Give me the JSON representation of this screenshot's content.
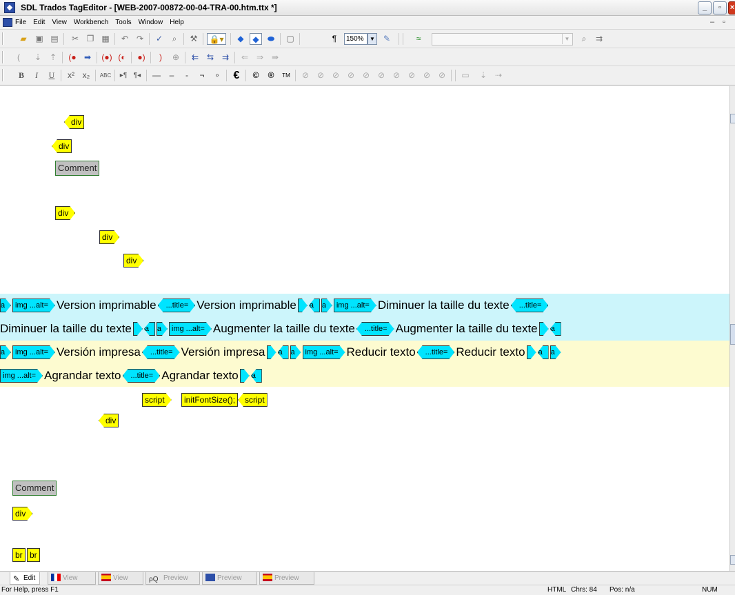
{
  "window": {
    "title": "SDL Trados TagEditor - [WEB-2007-00872-00-04-TRA-00.htm.ttx *]",
    "min_label": "_",
    "max_label": "▫",
    "close_label": "×"
  },
  "menu": {
    "items": [
      "File",
      "Edit",
      "View",
      "Workbench",
      "Tools",
      "Window",
      "Help"
    ],
    "mdi_min": "–",
    "mdi_restore": "▫"
  },
  "toolbar": {
    "zoom_value": "150%"
  },
  "editor": {
    "structure_tags": {
      "div1": "div",
      "div2": "div",
      "comment1": "Comment",
      "div3": "div",
      "div4": "div",
      "div5": "div",
      "script_open": "script",
      "script_content": "initFontSize();",
      "script_close": "script",
      "div6": "div",
      "comment2": "Comment",
      "div7": "div",
      "br1": "br",
      "br2": "br"
    },
    "source_segment": {
      "a": "a",
      "img_alt": "img ...alt=",
      "title_attr": "...title=",
      "text1": "Version imprimable",
      "text2": "Version imprimable",
      "text3": "Diminuer la taille du texte",
      "text4": "Diminuer la taille du texte",
      "text5": "Augmenter la taille du texte",
      "text6": "Augmenter la taille du texte"
    },
    "target_segment": {
      "a": "a",
      "img_alt": "img ...alt=",
      "title_attr": "...title=",
      "text1": "Versión impresa",
      "text2": "Versión impresa",
      "text3": "Reducir texto",
      "text4": "Reducir texto",
      "text5": "Agrandar texto",
      "text6": "Agrandar texto"
    }
  },
  "tabs": [
    {
      "label": "Edit",
      "icon": "edit-icon",
      "active": true
    },
    {
      "label": "View",
      "icon": "french-flag-icon",
      "active": false
    },
    {
      "label": "View",
      "icon": "spanish-flag-icon",
      "active": false
    },
    {
      "label": "Preview",
      "icon": "preview-icon",
      "active": false
    },
    {
      "label": "Preview",
      "icon": "french-preview-icon",
      "active": false
    },
    {
      "label": "Preview",
      "icon": "spanish-preview-icon",
      "active": false
    }
  ],
  "status": {
    "help": "For Help, press F1",
    "mode": "HTML",
    "chars": "Chrs:  84",
    "pos": "Pos: n/a",
    "num": "NUM"
  },
  "colors": {
    "structure_tag": "#ffff00",
    "inline_tag": "#00e4ff",
    "source_bg": "#ccf5fb",
    "target_bg": "#fdfbd0",
    "comment_bg": "#c0c0c0"
  }
}
